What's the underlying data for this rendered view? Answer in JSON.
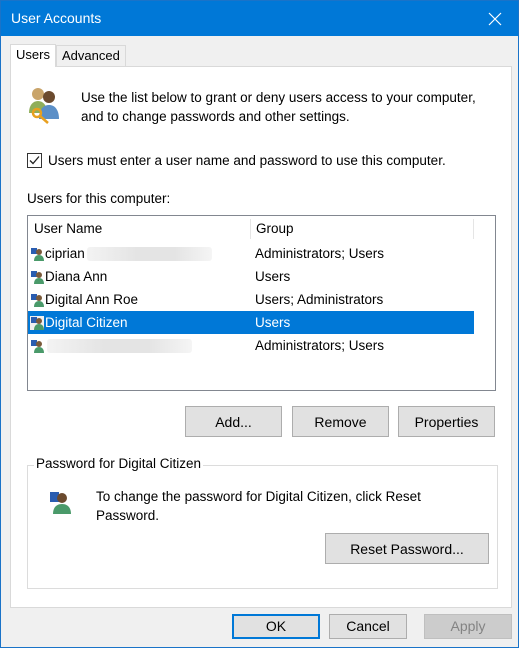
{
  "window": {
    "title": "User Accounts",
    "close_icon": "close-icon"
  },
  "tabs": [
    {
      "label": "Users",
      "active": true
    },
    {
      "label": "Advanced",
      "active": false
    }
  ],
  "intro": {
    "icon": "users-key-icon",
    "text": "Use the list below to grant or deny users access to your computer, and to change passwords and other settings."
  },
  "require_login": {
    "label": "Users must enter a user name and password to use this computer.",
    "checked": true
  },
  "users_list": {
    "label": "Users for this computer:",
    "columns": [
      "User Name",
      "Group"
    ],
    "rows": [
      {
        "name": "ciprian",
        "redacted_suffix": true,
        "group": "Administrators; Users",
        "selected": false
      },
      {
        "name": "Diana Ann",
        "redacted_suffix": false,
        "group": "Users",
        "selected": false
      },
      {
        "name": "Digital Ann Roe",
        "redacted_suffix": false,
        "group": "Users; Administrators",
        "selected": false
      },
      {
        "name": "Digital Citizen",
        "redacted_suffix": false,
        "group": "Users",
        "selected": true
      },
      {
        "name": "",
        "redacted_suffix": true,
        "group": "Administrators; Users",
        "selected": false
      }
    ]
  },
  "list_buttons": {
    "add": "Add...",
    "remove": "Remove",
    "properties": "Properties"
  },
  "password_group": {
    "title": "Password for Digital Citizen",
    "icon": "user-icon",
    "text": "To change the password for Digital Citizen, click Reset Password.",
    "reset_button": "Reset Password..."
  },
  "footer": {
    "ok": "OK",
    "cancel": "Cancel",
    "apply": "Apply",
    "apply_disabled": true
  },
  "colors": {
    "accent": "#0078d7",
    "selection": "#0078d7"
  }
}
